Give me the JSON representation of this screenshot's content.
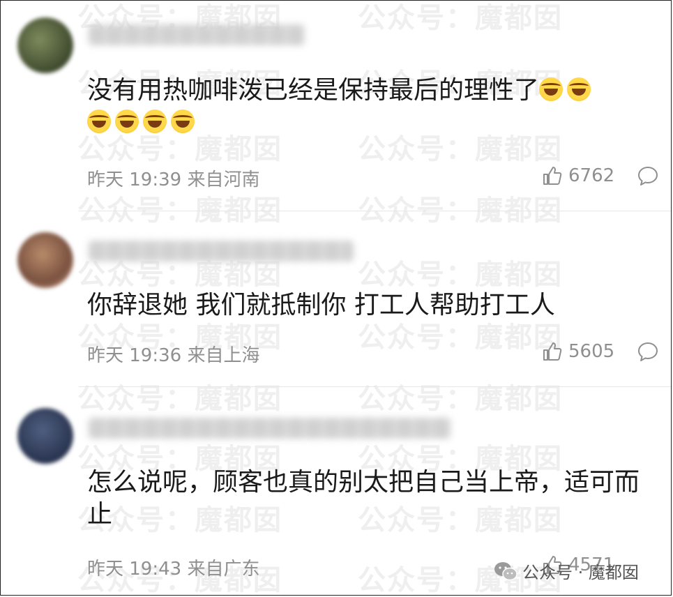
{
  "watermark_text": "公众号：魔都囡",
  "comments": [
    {
      "text": "没有用热咖啡泼已经是保持最后的理性了",
      "emoji_name": "laughing-tears",
      "time": "昨天 19:39",
      "location": "来自河南",
      "likes": "6762"
    },
    {
      "text": "你辞退她 我们就抵制你 打工人帮助打工人",
      "time": "昨天 19:36",
      "location": "来自上海",
      "likes": "5605"
    },
    {
      "text": "怎么说呢，顾客也真的别太把自己当上帝，适可而止",
      "time": "昨天 19:43",
      "location": "来自广东",
      "likes": "4571"
    }
  ],
  "footer": {
    "account_label": "公众号 · 魔都囡",
    "icon": "wechat-icon"
  },
  "colors": {
    "meta_gray": "#8f8f8f",
    "divider": "#e6e6e6",
    "watermark": "#efefef"
  }
}
